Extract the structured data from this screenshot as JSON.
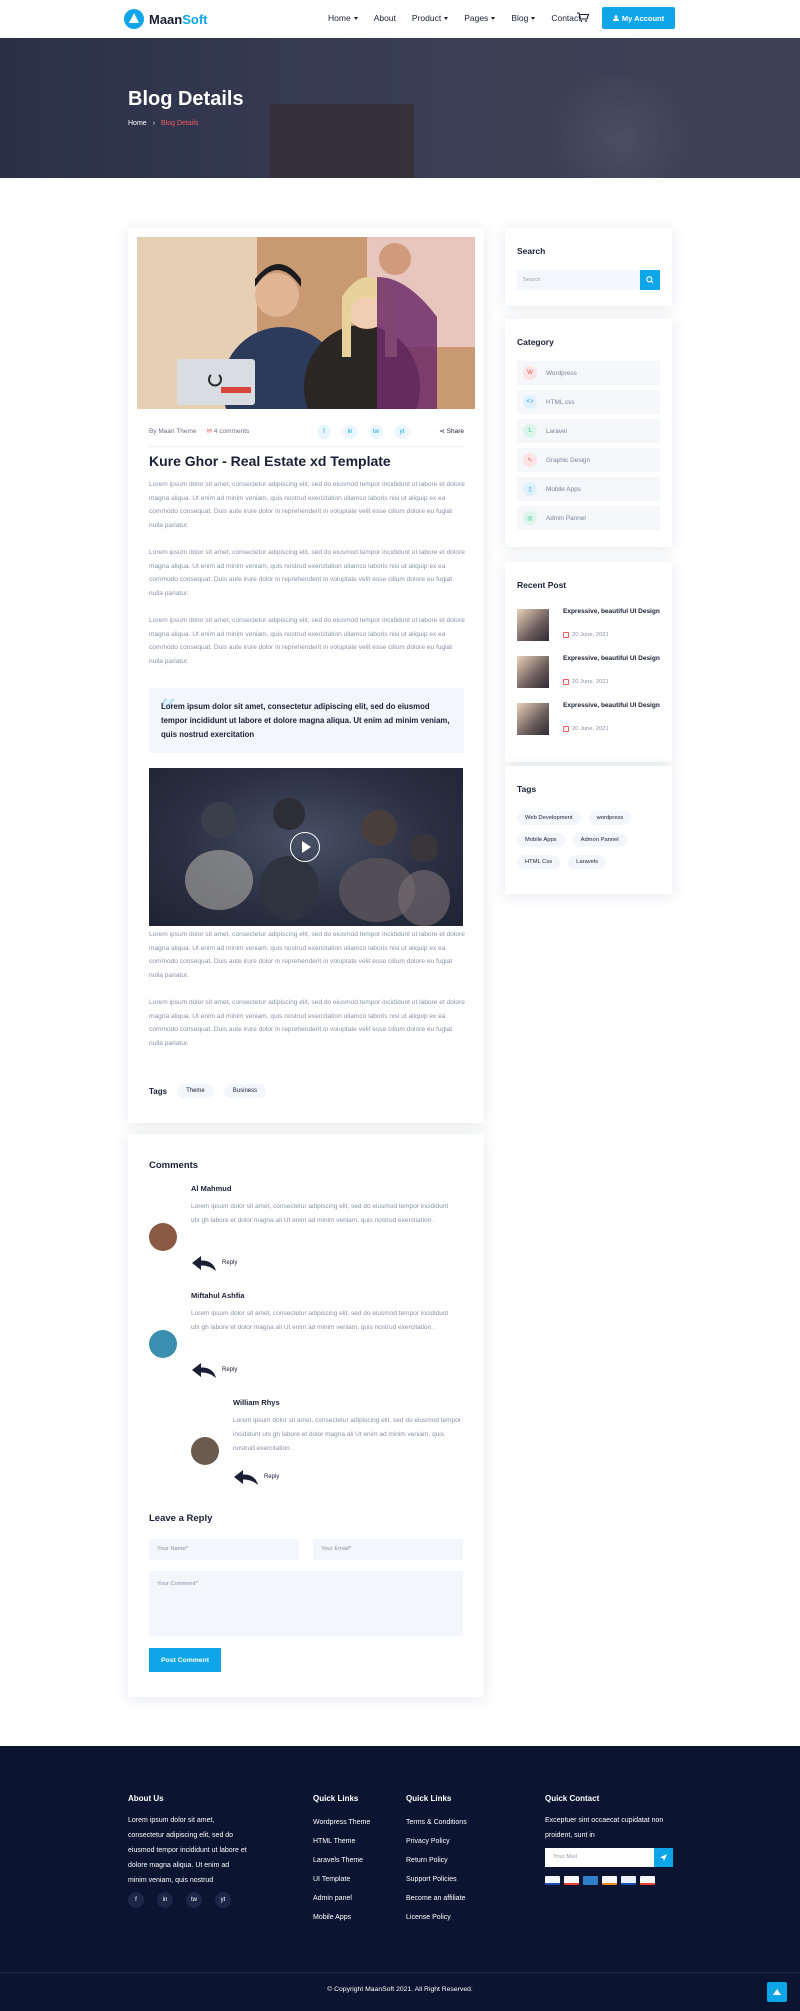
{
  "brand": {
    "name_part1": "Maan",
    "name_part2": "Soft"
  },
  "nav": {
    "items": [
      {
        "label": "Home",
        "has_caret": true
      },
      {
        "label": "About",
        "has_caret": false
      },
      {
        "label": "Product",
        "has_caret": true
      },
      {
        "label": "Pages",
        "has_caret": true
      },
      {
        "label": "Blog",
        "has_caret": true
      },
      {
        "label": "Contact",
        "has_caret": false
      }
    ],
    "account_label": "My Account",
    "cart_icon": "cart-icon",
    "user_icon": "user-icon"
  },
  "hero": {
    "title": "Blog Details",
    "crumbs": [
      "Home",
      "Blog Details"
    ]
  },
  "post": {
    "author": "By Maan Theme",
    "comments": "4 comments",
    "share": "Share",
    "social_icons": [
      "f",
      "in",
      "tw",
      "yt"
    ],
    "title": "Kure Ghor - Real Estate xd Template",
    "paragraphs": [
      "Lorem ipsum dolor sit amet, consectetur adipiscing elit, sed do eiusmod tempor incididunt ut labore et dolore magna aliqua. Ut enim ad minim veniam, quis nostrud exercitation ullamco laboris nisi ut aliquip ex ea commodo consequat. Duis aute irure dolor in reprehenderit in voluptate velit esse cillum dolore eu fugiat nulla pariatur.",
      "Lorem ipsum dolor sit amet, consectetur adipiscing elit, sed do eiusmod tempor incididunt ut labore et dolore magna aliqua. Ut enim ad minim veniam, quis nostrud exercitation ullamco laboris nisi ut aliquip ex ea commodo consequat. Duis aute irure dolor in reprehenderit in voluptate velit esse cillum dolore eu fugiat nulla pariatur.",
      "Lorem ipsum dolor sit amet, consectetur adipiscing elit, sed do eiusmod tempor incididunt ut labore et dolore magna aliqua. Ut enim ad minim veniam, quis nostrud exercitation ullamco laboris nisi ut aliquip ex ea commodo consequat. Duis aute irure dolor in reprehenderit in voluptate velit esse cillum dolore eu fugiat nulla pariatur.",
      "Lorem ipsum dolor sit amet, consectetur adipiscing elit, sed do eiusmod tempor incididunt ut labore et dolore magna aliqua. Ut enim ad minim veniam, quis nostrud exercitation ullamco laboris nisi ut aliquip ex ea commodo consequat. Duis aute irure dolor in reprehenderit in voluptate velit esse cillum dolore eu fugiat nulla pariatur.",
      "Lorem ipsum dolor sit amet, consectetur adipiscing elit, sed do eiusmod tempor incididunt ut labore et dolore magna aliqua. Ut enim ad minim veniam, quis nostrud exercitation ullamco laboris nisi ut aliquip ex ea commodo consequat. Duis aute irure dolor in reprehenderit in voluptate velit esse cillum dolore eu fugiat nulla pariatur."
    ],
    "quote": "Lorem ipsum dolor sit amet, consectetur adipiscing elit, sed do eiusmod tempor incididunt ut labore et dolore magna aliqua. Ut enim ad minim veniam, quis nostrud exercitation",
    "tags_label": "Tags",
    "tags": [
      "Theme",
      "Business"
    ]
  },
  "sidebar": {
    "search": {
      "title": "Search",
      "placeholder": "Search"
    },
    "category": {
      "title": "Category",
      "items": [
        {
          "label": "Wordpress",
          "icon": "wordpress-icon",
          "bg": "#fde5e5",
          "fg": "#e25a5a",
          "glyph": "W"
        },
        {
          "label": "HTML css",
          "icon": "html-icon",
          "bg": "#dff1fd",
          "fg": "#2aa4e8",
          "glyph": "<>"
        },
        {
          "label": "Laravel",
          "icon": "laravel-icon",
          "bg": "#dcf5ea",
          "fg": "#2cbf82",
          "glyph": "L"
        },
        {
          "label": "Graphic Design",
          "icon": "graphic-design-icon",
          "bg": "#fde5e5",
          "fg": "#e25a5a",
          "glyph": "✎"
        },
        {
          "label": "Mobile Apps",
          "icon": "mobile-apps-icon",
          "bg": "#dff1fd",
          "fg": "#2aa4e8",
          "glyph": "▯"
        },
        {
          "label": "Admin Pannel",
          "icon": "admin-panel-icon",
          "bg": "#dcf5ea",
          "fg": "#2cbf82",
          "glyph": "◎"
        }
      ]
    },
    "recent": {
      "title": "Recent Post",
      "items": [
        {
          "title": "Expressive, beautiful UI Design",
          "date": "20 June, 2021"
        },
        {
          "title": "Expressive, beautiful UI Design",
          "date": "20 June, 2021"
        },
        {
          "title": "Expressive, beautiful UI Design",
          "date": "20 June, 2021"
        }
      ]
    },
    "tags": {
      "title": "Tags",
      "items": [
        "Web Development",
        "wordpress",
        "Mobile Apps",
        "Admon Pannel",
        "HTML Css",
        "Laravels"
      ]
    }
  },
  "comments": {
    "title": "Comments",
    "items": [
      {
        "name": "Al Mahmud",
        "text": "Lorem ipsum dolor sit amet, consectetur adipiscing elit, sed do eiusmod tempor incididunt utx gh labore et dolor magna ali Ut enim ad minim veniam, quis nostrud exercitation .",
        "reply": "Reply",
        "avatar_color": "#8a5a44"
      },
      {
        "name": "Miftahul Ashfia",
        "text": "Lorem ipsum dolor sit amet, consectetur adipiscing elit, sed do eiusmod tempor incididunt utx gh labore et dolor magna ali Ut enim ad minim veniam, quis nostrud exercitation .",
        "reply": "Reply",
        "avatar_color": "#3a8fb0"
      },
      {
        "name": "William Rhys",
        "text": "Lorem ipsum dolor sit amet, consectetur adipiscing elit, sed do eiusmod tempor incididunt utx gh labore et dolor magna ali Ut enim ad minim veniam, quis nostrud exercitation .",
        "reply": "Reply",
        "avatar_color": "#6b5b4e"
      }
    ],
    "reply_form": {
      "title": "Leave a Reply",
      "name_placeholder": "Your Name*",
      "email_placeholder": "Your Email*",
      "comment_placeholder": "Your Comment*",
      "submit": "Post Comment"
    }
  },
  "footer": {
    "about": {
      "title": "About Us",
      "text": "Lorem ipsum dolor sit amet, consectetur adipiscing elit, sed do eiusmod tempor incididunt ut labore et dolore magna aliqua. Ut enim ad minim veniam, quis nostrud",
      "socials": [
        "f",
        "in",
        "tw",
        "yt"
      ]
    },
    "quick_links_1": {
      "title": "Quick Links",
      "items": [
        "Wordpress Theme",
        "HTML Theme",
        "Laravels Theme",
        "UI Template",
        "Admin panel",
        "Mobile Apps"
      ]
    },
    "quick_links_2": {
      "title": "Quick Links",
      "items": [
        "Terms & Conditions",
        "Privacy Policy",
        "Return Policy",
        "Support Policies",
        "Become an affiliate",
        "License Policy"
      ]
    },
    "contact": {
      "title": "Quick Contact",
      "text": "Exceptuer sint occaecat cupidatat non proident, sunt in",
      "mail_placeholder": "Your Mail",
      "payment_icons": [
        "visa",
        "mastercard",
        "amex",
        "discover",
        "paypal",
        "maestro"
      ]
    },
    "copyright": "© Copyright MaanSoft 2021. All Right Reserved."
  },
  "colors": {
    "accent": "#0ea5e9",
    "dark": "#0b1430",
    "heading": "#1a1f36",
    "crumb_active": "#f25a5a"
  }
}
